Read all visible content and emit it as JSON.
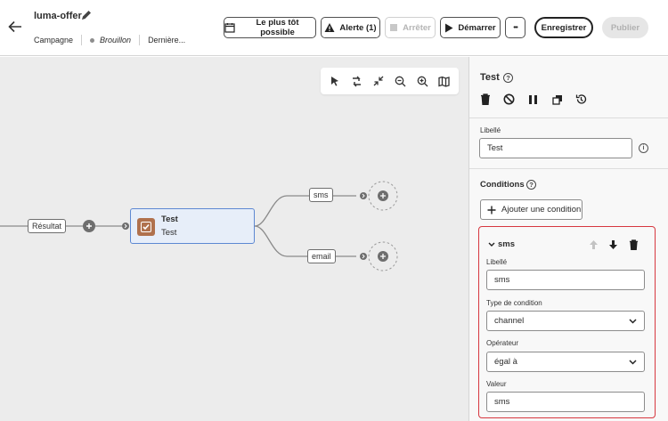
{
  "header": {
    "title": "luma-offer",
    "type": "Campagne",
    "status": "Brouillon",
    "last": "Dernière...",
    "buttons": {
      "asap": "Le plus tôt possible",
      "alert": "Alerte (1)",
      "stop": "Arrêter",
      "start": "Démarrer",
      "more": "•••",
      "save": "Enregistrer",
      "publish": "Publier"
    }
  },
  "canvas": {
    "result_label": "Résultat",
    "node_title": "Test",
    "node_subtitle": "Test",
    "branch_sms": "sms",
    "branch_email": "email"
  },
  "panel": {
    "title": "Test",
    "label_caption": "Libellé",
    "label_value": "Test",
    "conditions_title": "Conditions",
    "add_condition": "Ajouter une condition",
    "condition": {
      "name": "sms",
      "label_caption": "Libellé",
      "label_value": "sms",
      "type_caption": "Type de condition",
      "type_value": "channel",
      "operator_caption": "Opérateur",
      "operator_value": "égal à",
      "value_caption": "Valeur",
      "value_value": "sms"
    }
  },
  "colors": {
    "node_bg": "#e7eef9",
    "node_border": "#5d88d2",
    "node_icon": "#b0714d",
    "highlight": "#d7373f",
    "canvas_bg": "#ececec"
  }
}
